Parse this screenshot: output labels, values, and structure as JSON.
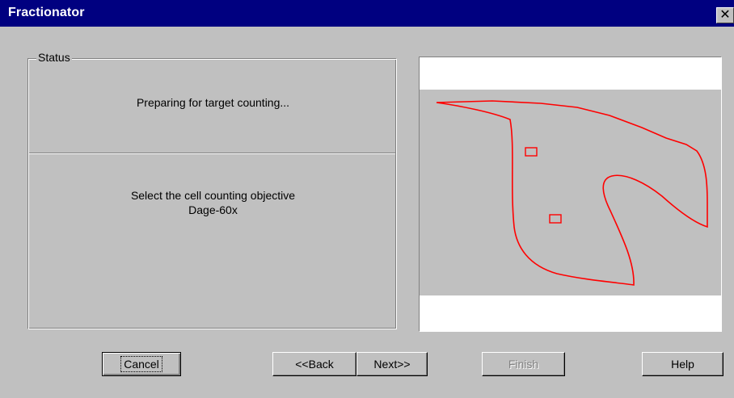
{
  "window": {
    "title": "Fractionator",
    "close_glyph": "✕"
  },
  "status": {
    "legend": "Status",
    "message": "Preparing for target counting...",
    "instruction_line1": "Select the cell counting objective",
    "instruction_line2": "Dage-60x"
  },
  "preview": {
    "band_color": "#ffffff",
    "image_background": "#c0c0c0",
    "outline_color": "#ff0000"
  },
  "buttons": {
    "cancel": "Cancel",
    "back": "<<Back",
    "next": "Next>>",
    "finish": "Finish",
    "help": "Help"
  }
}
